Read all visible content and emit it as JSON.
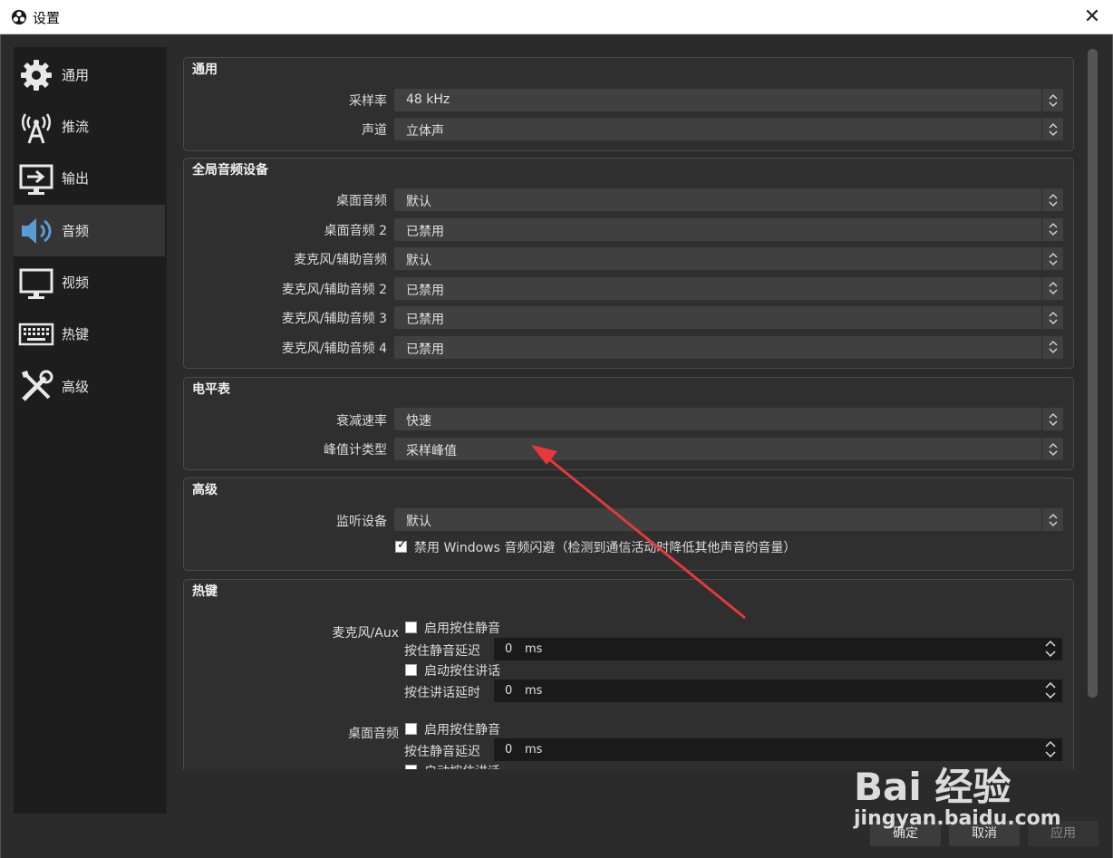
{
  "window": {
    "title": "设置",
    "close_label": "✕"
  },
  "sidebar": {
    "items": [
      {
        "label": "通用",
        "icon": "gear-icon"
      },
      {
        "label": "推流",
        "icon": "antenna-icon"
      },
      {
        "label": "输出",
        "icon": "output-icon"
      },
      {
        "label": "音频",
        "icon": "speaker-icon",
        "active": true
      },
      {
        "label": "视频",
        "icon": "monitor-icon"
      },
      {
        "label": "热键",
        "icon": "keyboard-icon"
      },
      {
        "label": "高级",
        "icon": "tools-icon"
      }
    ]
  },
  "general": {
    "title": "通用",
    "sample_rate_label": "采样率",
    "sample_rate_value": "48 kHz",
    "channels_label": "声道",
    "channels_value": "立体声"
  },
  "global_audio": {
    "title": "全局音频设备",
    "rows": [
      {
        "label": "桌面音频",
        "value": "默认"
      },
      {
        "label": "桌面音频 2",
        "value": "已禁用"
      },
      {
        "label": "麦克风/辅助音频",
        "value": "默认"
      },
      {
        "label": "麦克风/辅助音频 2",
        "value": "已禁用"
      },
      {
        "label": "麦克风/辅助音频 3",
        "value": "已禁用"
      },
      {
        "label": "麦克风/辅助音频 4",
        "value": "已禁用"
      }
    ]
  },
  "meters": {
    "title": "电平表",
    "decay_label": "衰减速率",
    "decay_value": "快速",
    "peak_label": "峰值计类型",
    "peak_value": "采样峰值"
  },
  "advanced": {
    "title": "高级",
    "monitor_label": "监听设备",
    "monitor_value": "默认",
    "ducking_label": "禁用 Windows 音频闪避（检测到通信活动时降低其他声音的音量）",
    "ducking_checked": true
  },
  "hotkeys": {
    "title": "热键",
    "mic": {
      "name": "麦克风/Aux",
      "push_to_mute_label": "启用按住静音",
      "push_to_mute_delay_label": "按住静音延迟",
      "push_to_mute_delay_value": "0",
      "unit": "ms",
      "push_to_talk_label": "启动按住讲话",
      "push_to_talk_delay_label": "按住讲话延时",
      "push_to_talk_delay_value": "0"
    },
    "desktop": {
      "name": "桌面音频",
      "push_to_mute_label": "启用按住静音",
      "push_to_mute_delay_label": "按住静音延迟",
      "push_to_mute_delay_value": "0",
      "unit": "ms",
      "push_to_talk_label": "启动按住讲话"
    }
  },
  "footer": {
    "ok_label": "确定",
    "cancel_label": "取消",
    "apply_label": "应用"
  },
  "watermark": {
    "text": "Bai 经验",
    "url_text": "jingyan.baidu.com"
  },
  "colors": {
    "background": "#2b2b2b",
    "sidebar": "#1d1d1d",
    "annotation_arrow": "#e8383a"
  }
}
